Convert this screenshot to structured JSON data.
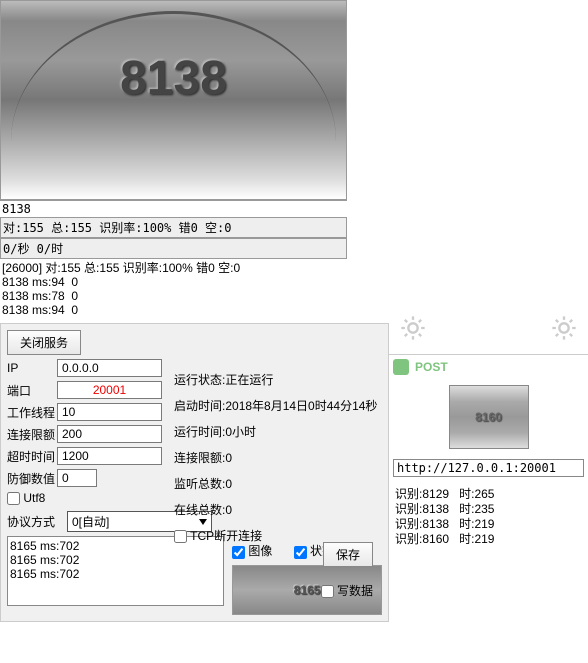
{
  "top_image": {
    "part_number": "8138"
  },
  "result_text": "8138",
  "stats1": "对:155 总:155 识别率:100% 错0 空:0",
  "stats2": "0/秒 0/时",
  "log_lines": [
    "[26000] 对:155 总:155 识别率:100% 错0 空:0",
    "8138 ms:94  0",
    "8138 ms:78  0",
    "8138 ms:94  0"
  ],
  "server": {
    "close_btn": "关闭服务",
    "ip_label": "IP",
    "ip_value": "0.0.0.0",
    "port_label": "端口",
    "port_value": "20001",
    "threads_label": "工作线程",
    "threads_value": "10",
    "connlimit_label": "连接限额",
    "connlimit_value": "200",
    "timeout_label": "超时时间",
    "timeout_value": "1200",
    "defense_label": "防御数值",
    "defense_value": "0",
    "utf8_label": "Utf8",
    "status_running_label": "运行状态:",
    "status_running_value": "正在运行",
    "start_time_label": "启动时间:",
    "start_time_value": "2018年8月14日0时44分14秒",
    "uptime_label": "运行时间:",
    "uptime_value": "0小时",
    "conn_limit2_label": "连接限额:",
    "conn_limit2_value": "0",
    "listen_label": "监听总数:",
    "listen_value": "0",
    "online_label": "在线总数:",
    "online_value": "0",
    "tcp_disconnect_label": "TCP断开连接",
    "save_btn": "保存",
    "proto_label": "协议方式",
    "proto_value": "0[自动]",
    "write_data_label": "写数据",
    "image_cb": "图像",
    "status_cb": "状态",
    "bottom_log": [
      "8165 ms:702",
      "8165 ms:702",
      "8165 ms:702"
    ],
    "preview_number": "8165"
  },
  "post": {
    "title": "POST",
    "thumb_number": "8160",
    "url": "http://127.0.0.1:20001",
    "rows": [
      {
        "k": "识别",
        "v1": "8129",
        "k2": "时",
        "v2": "265"
      },
      {
        "k": "识别",
        "v1": "8138",
        "k2": "时",
        "v2": "235"
      },
      {
        "k": "识别",
        "v1": "8138",
        "k2": "时",
        "v2": "219"
      },
      {
        "k": "识别",
        "v1": "8160",
        "k2": "时",
        "v2": "219"
      }
    ]
  }
}
